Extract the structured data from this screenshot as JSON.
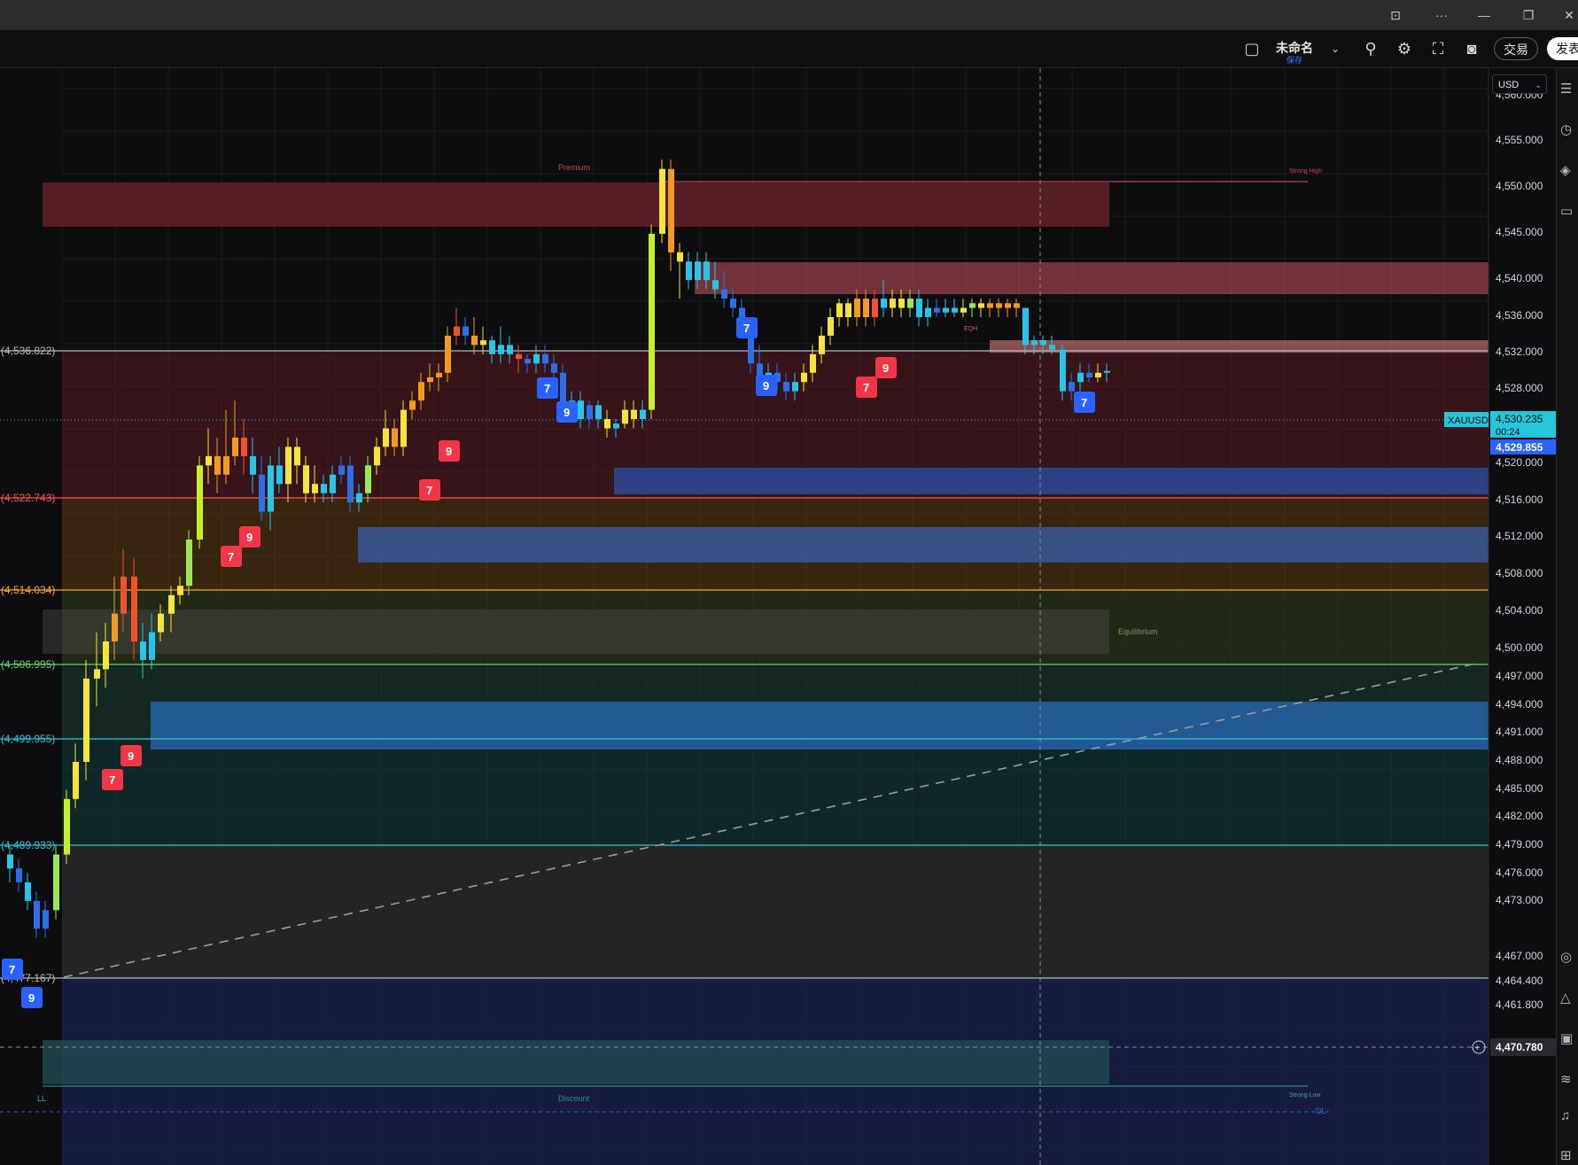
{
  "titlebar": {
    "controls": [
      "⊡",
      "···",
      "—",
      "❐",
      "✕"
    ]
  },
  "toolbar": {
    "layout_name": "未命名",
    "layout_saved": "保存",
    "trade_label": "交易",
    "publish_label": "发表"
  },
  "currency": "USD",
  "symbol": "XAUUSD",
  "price_now": "4,530.235",
  "countdown": "00:24",
  "price_alt": "4,529.855",
  "crosshair_price": "4,470.780",
  "axis_ticks": [
    "4,560.000",
    "4,555.000",
    "4,550.000",
    "4,545.000",
    "4,540.000",
    "4,536.000",
    "4,532.000",
    "4,528.000",
    "4,524.000",
    "4,520.000",
    "4,516.000",
    "4,512.000",
    "4,508.000",
    "4,504.000",
    "4,500.000",
    "4,497.000",
    "4,494.000",
    "4,491.000",
    "4,488.000",
    "4,485.000",
    "4,482.000",
    "4,479.000",
    "4,476.000",
    "4,473.000",
    "4,467.000",
    "4,464.400",
    "4,461.800"
  ],
  "levels": [
    {
      "price": "(4,536.822)",
      "color": "#b9b9b9"
    },
    {
      "price": "(4,522.743)",
      "color": "#ff4d4d"
    },
    {
      "price": "(4,514.034)",
      "color": "#ffa726"
    },
    {
      "price": "(4,506.995)",
      "color": "#66d36e"
    },
    {
      "price": "(4,499.955)",
      "color": "#26c6da"
    },
    {
      "price": "(4,489.933)",
      "color": "#26c6da"
    },
    {
      "price": "(4,477.167)",
      "color": "#b9b9b9"
    }
  ],
  "zone_labels": {
    "premium": "Premium",
    "strong_high": "Strong High",
    "equilibrium": "Equilibrium",
    "discount": "Discount",
    "strong_low": "Strong Low",
    "eqh": "EQH",
    "ll": "LL",
    "dl": "DL"
  },
  "markers": [
    {
      "text": "7",
      "color": "#2962ff"
    },
    {
      "text": "9",
      "color": "#2962ff"
    },
    {
      "text": "7",
      "color": "#f23645"
    },
    {
      "text": "9",
      "color": "#f23645"
    }
  ],
  "colors": {
    "bull": "#26a69a",
    "bear": "#ef5350",
    "premium_zone": "#b02a37",
    "discount_zone": "#1a2a6c",
    "ob_blue": "#2962ff"
  }
}
